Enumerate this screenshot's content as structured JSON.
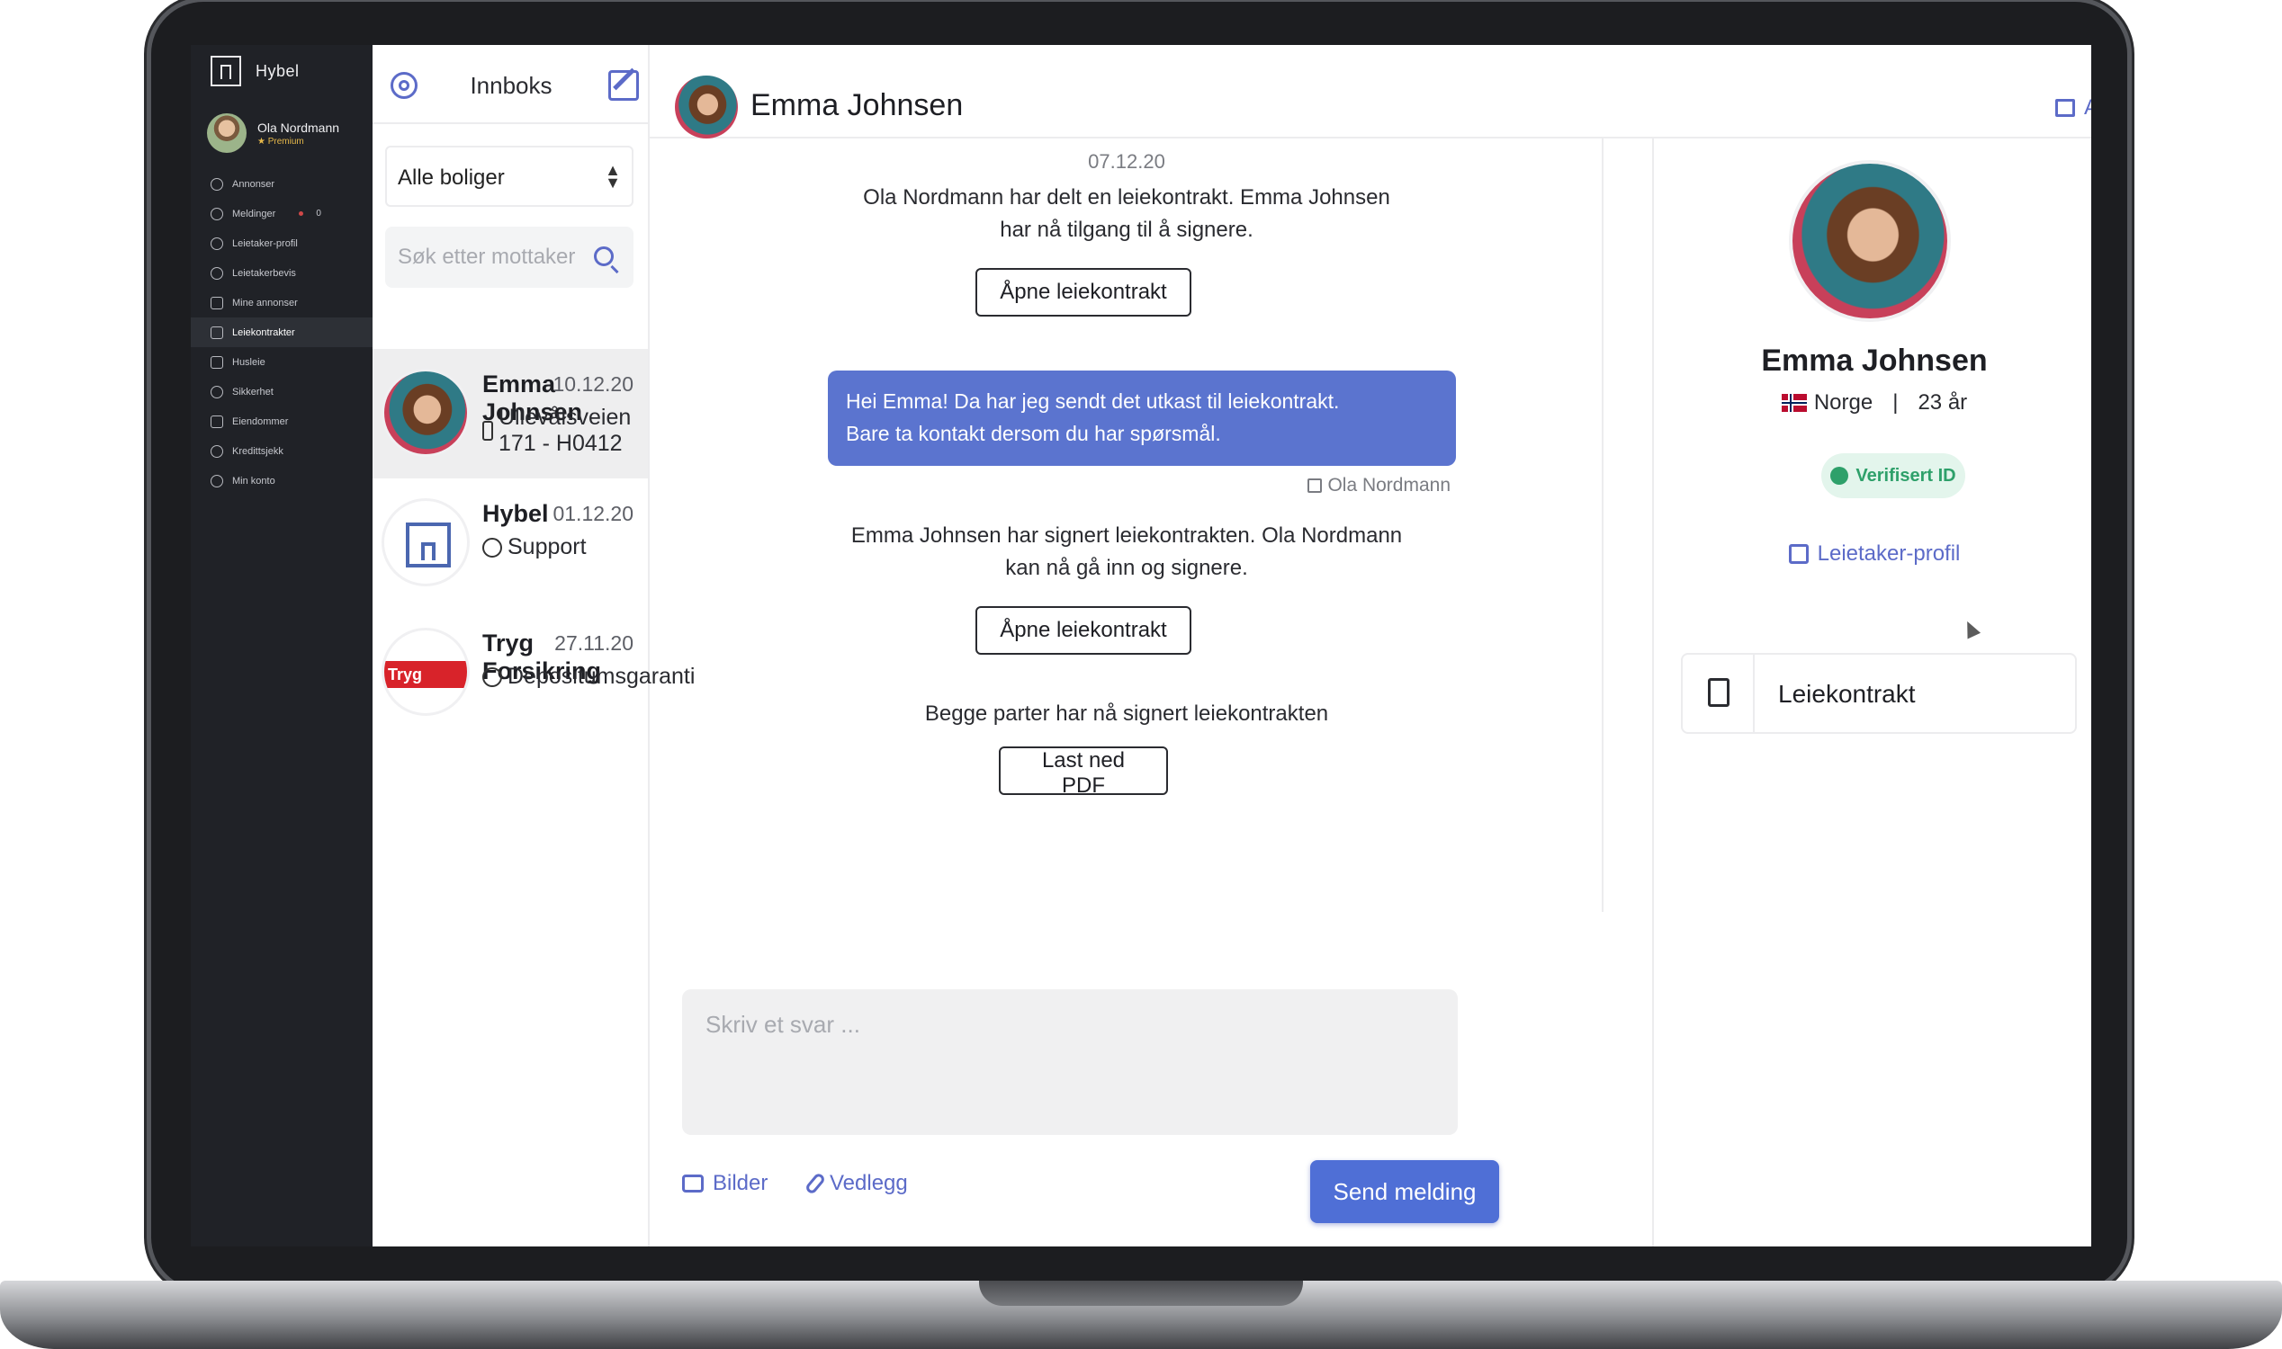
{
  "app": {
    "brand": "Hybel"
  },
  "user": {
    "name": "Ola Nordmann",
    "tier": "Premium"
  },
  "nav": {
    "items": [
      {
        "label": "Annonser",
        "icon": "search-icon"
      },
      {
        "label": "Meldinger",
        "icon": "chat-icon",
        "count": "0"
      },
      {
        "label": "Leietaker-profil",
        "icon": "user-icon"
      },
      {
        "label": "Leietakerbevis",
        "icon": "check-circle-icon"
      },
      {
        "label": "Mine annonser",
        "icon": "list-icon"
      },
      {
        "label": "Leiekontrakter",
        "icon": "document-icon",
        "active": true
      },
      {
        "label": "Husleie",
        "icon": "money-icon"
      },
      {
        "label": "Sikkerhet",
        "icon": "shield-icon"
      },
      {
        "label": "Eiendommer",
        "icon": "building-icon"
      },
      {
        "label": "Kredittsjekk",
        "icon": "magnifier-icon"
      },
      {
        "label": "Min konto",
        "icon": "account-icon"
      }
    ]
  },
  "inbox": {
    "title": "Innboks",
    "filter": "Alle boliger",
    "search_placeholder": "Søk etter mottaker",
    "conversations": [
      {
        "name": "Emma Johnsen",
        "date": "10.12.20",
        "subtitle": "Ullevålsveien 171 - H0412",
        "icon": "document-icon"
      },
      {
        "name": "Hybel",
        "date": "01.12.20",
        "subtitle": "Support",
        "icon": "question-icon"
      },
      {
        "name": "Tryg Forsikring",
        "date": "27.11.20",
        "subtitle": "Depositumsgaranti",
        "icon": "shield-icon",
        "logo_text": "Tryg"
      }
    ]
  },
  "chat": {
    "contact": "Emma Johnsen",
    "archive_label": "Arkiver samtale",
    "date": "07.12.20",
    "system1_line1": "Ola Nordmann har delt en leiekontrakt. Emma Johnsen",
    "system1_line2": "har nå tilgang til å signere.",
    "open_contract_label": "Åpne leiekontrakt",
    "bubble_line1": "Hei Emma! Da har jeg sendt det utkast til leiekontrakt.",
    "bubble_line2": "Bare ta kontakt dersom du har spørsmål.",
    "bubble_sender": "Ola Nordmann",
    "system2_line1": "Emma Johnsen har signert leiekontrakten. Ola Nordmann",
    "system2_line2": "kan nå gå inn og signere.",
    "system3": "Begge parter har nå signert leiekontrakten",
    "download_label": "Last ned PDF",
    "reply_placeholder": "Skriv et svar ...",
    "images_label": "Bilder",
    "attachment_label": "Vedlegg",
    "send_label": "Send melding",
    "accent": "#5b74cf"
  },
  "profile": {
    "name": "Emma Johnsen",
    "country": "Norge",
    "age": "23 år",
    "verified_label": "Verifisert ID",
    "profile_link": "Leietaker-profil",
    "document_label": "Leiekontrakt"
  }
}
